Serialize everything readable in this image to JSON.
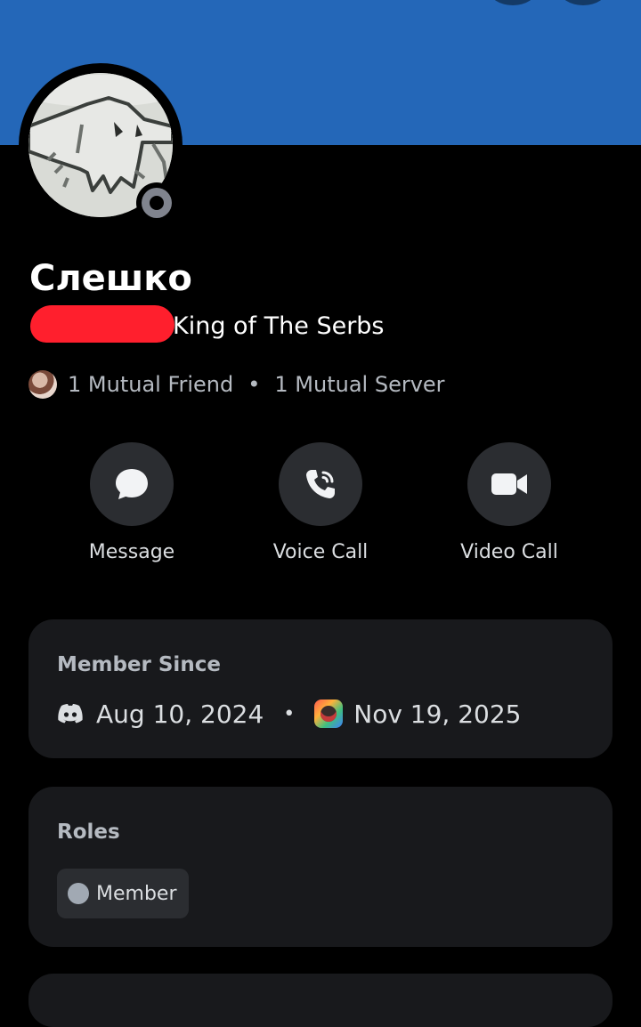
{
  "profile": {
    "display_name": "Слешко",
    "username_suffix": "King of The Serbs",
    "status": "offline",
    "banner_color": "#2467b8"
  },
  "mutuals": {
    "friends": "1 Mutual Friend",
    "separator": "•",
    "servers": "1 Mutual Server"
  },
  "actions": [
    {
      "label": "Message",
      "icon": "chat-bubble-icon"
    },
    {
      "label": "Voice Call",
      "icon": "phone-icon"
    },
    {
      "label": "Video Call",
      "icon": "video-camera-icon"
    }
  ],
  "member_since": {
    "title": "Member Since",
    "discord_date": "Aug 10, 2024",
    "separator": "•",
    "server_date": "Nov 19, 2025"
  },
  "roles": {
    "title": "Roles",
    "items": [
      {
        "label": "Member",
        "color": "#a1a9b3"
      }
    ]
  }
}
